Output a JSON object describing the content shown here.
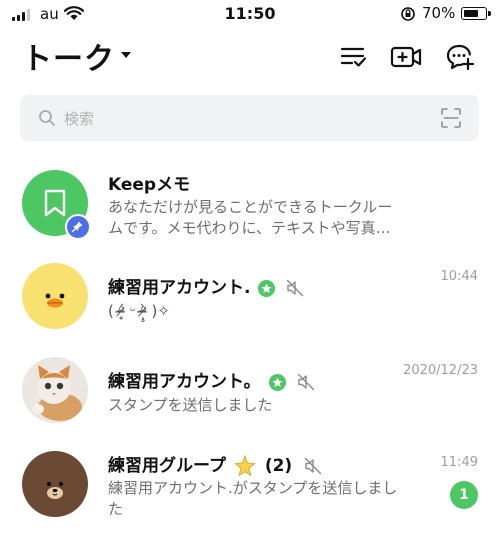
{
  "status_bar": {
    "carrier": "au",
    "time": "11:50",
    "battery": "70%",
    "battery_level": 0.7
  },
  "header": {
    "title": "トーク",
    "icons": [
      "checklist-icon",
      "video-add-icon",
      "chat-add-icon"
    ]
  },
  "search": {
    "placeholder": "検索"
  },
  "chats": [
    {
      "name": "Keepメモ",
      "message_line1": "あなただけが見ることができるトークルー",
      "message_line2": "ムです。メモ代わりに、テキストや写真…",
      "time": "",
      "avatar": "keep-bookmark",
      "pinned": true
    },
    {
      "name": "練習用アカウント.",
      "message": "( ᵒ̴̶̷̥́ ᵕ ᵒ̴̶̷̣̥̀ )✧",
      "time": "10:44",
      "official": true,
      "muted": true,
      "avatar": "chick"
    },
    {
      "name": "練習用アカウント。",
      "message": "スタンプを送信しました",
      "time": "2020/12/23",
      "official": true,
      "muted": true,
      "avatar": "kitten"
    },
    {
      "name": "練習用グループ",
      "count": "(2)",
      "message_line1": "練習用アカウント.がスタンプを送信しまし",
      "message_line2": "た",
      "time": "11:49",
      "muted": true,
      "unread": "1",
      "avatar": "bear"
    }
  ],
  "colors": {
    "accent_green": "#4cc764",
    "pin_blue": "#4d6fe6",
    "chick_yellow": "#f8e071",
    "bear_brown": "#6b4a35"
  }
}
